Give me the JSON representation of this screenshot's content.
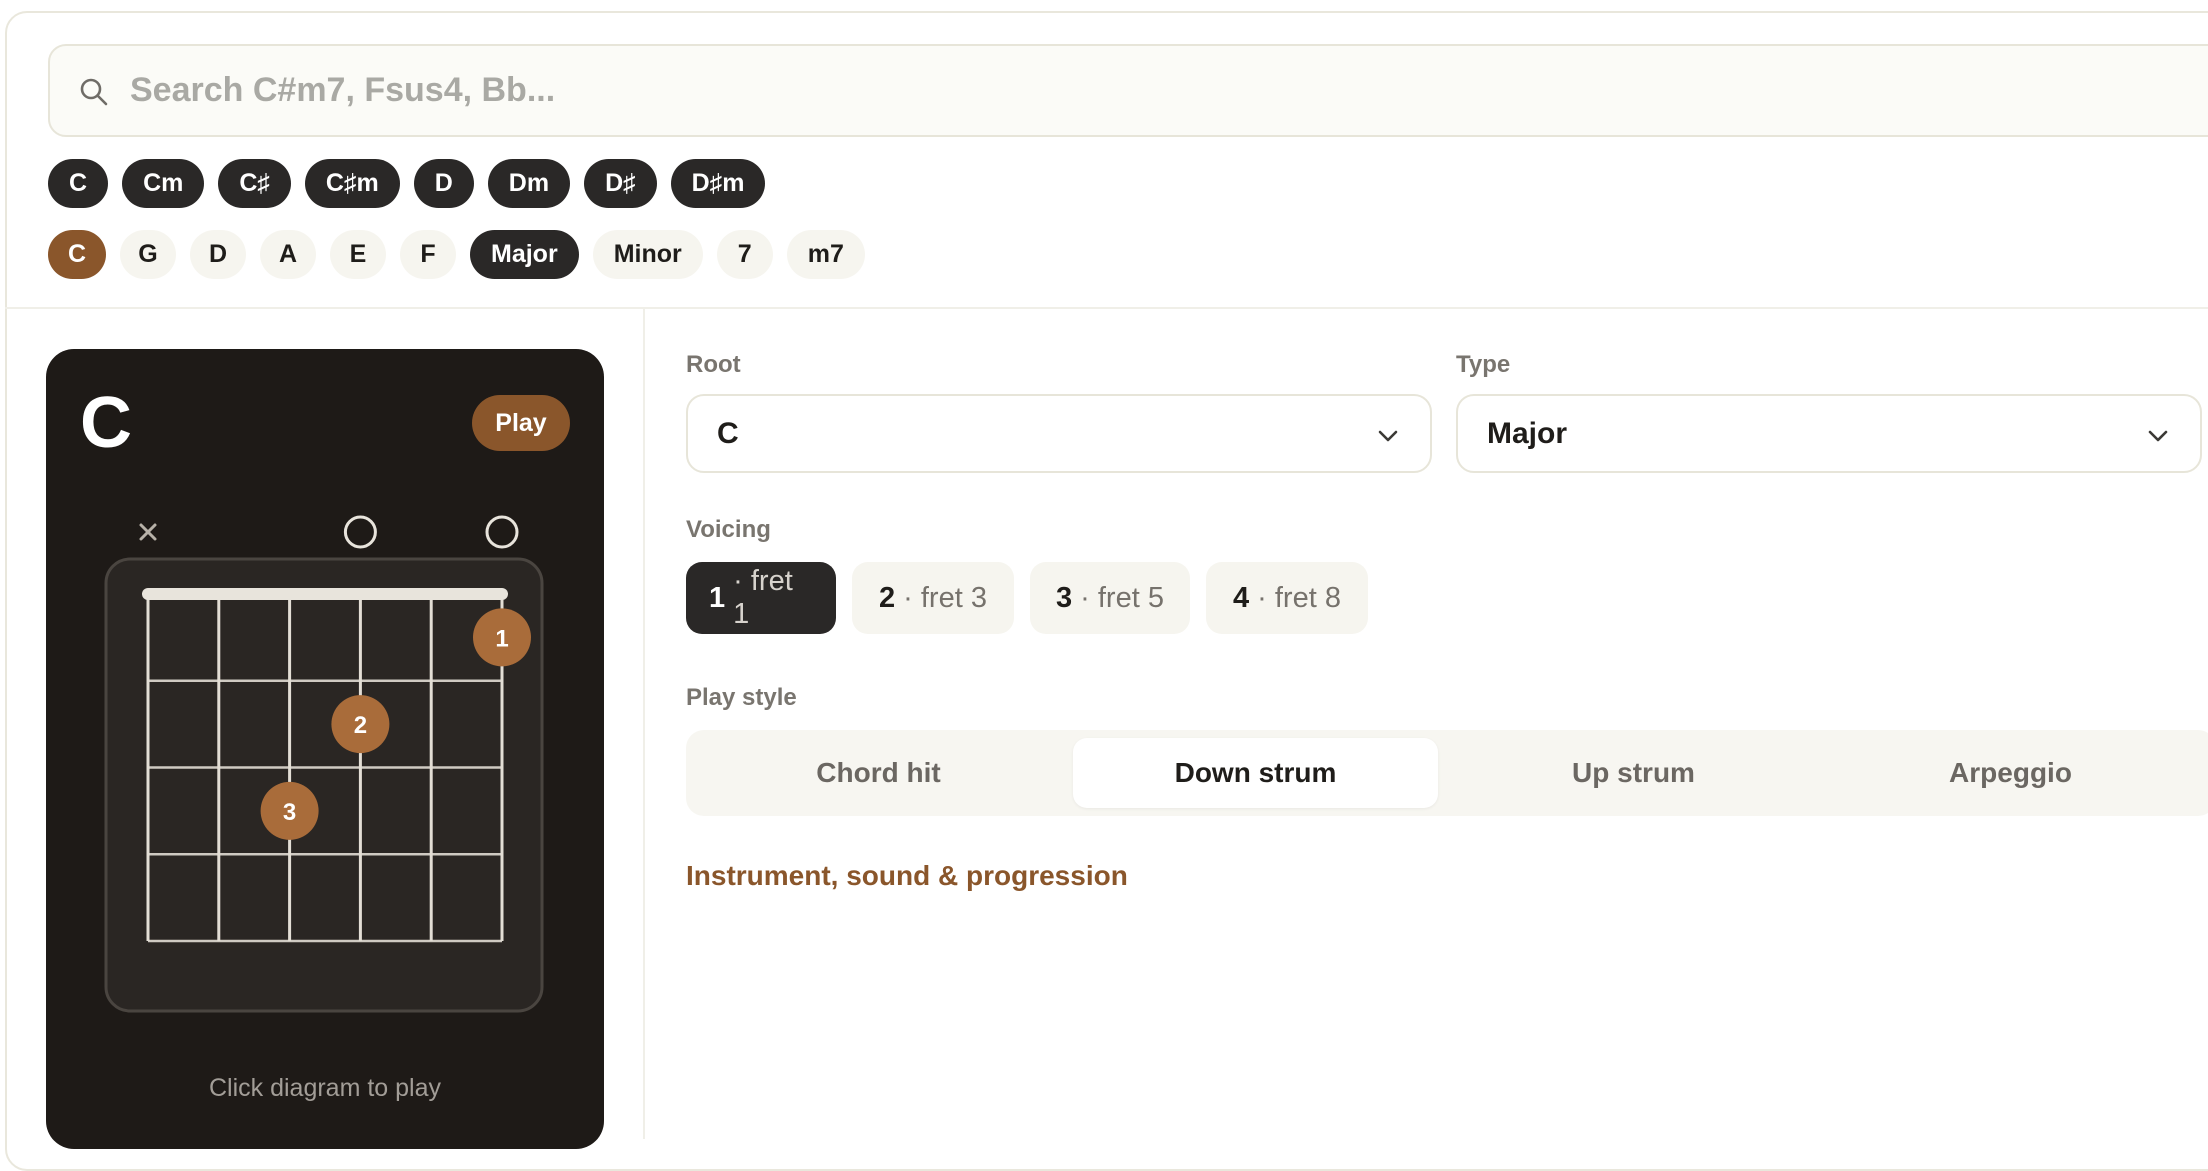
{
  "search": {
    "placeholder": "Search C#m7, Fsus4, Bb...",
    "value": ""
  },
  "recent_chords": [
    "C",
    "Cm",
    "C♯",
    "C♯m",
    "D",
    "Dm",
    "D♯",
    "D♯m"
  ],
  "quick_filters": {
    "roots": [
      "C",
      "G",
      "D",
      "A",
      "E",
      "F"
    ],
    "selected_root": "C",
    "types": [
      "Major",
      "Minor",
      "7",
      "m7"
    ],
    "selected_type": "Major"
  },
  "chord_card": {
    "name": "C",
    "play_label": "Play",
    "caption": "Click diagram to play",
    "diagram": {
      "strings": 6,
      "frets": 4,
      "string_markers": [
        "x",
        "",
        "",
        "o",
        "",
        "o"
      ],
      "fingers": [
        {
          "string": 5,
          "fret": 1,
          "label": "1"
        },
        {
          "string": 3,
          "fret": 2,
          "label": "2"
        },
        {
          "string": 2,
          "fret": 3,
          "label": "3"
        }
      ]
    }
  },
  "root_field": {
    "label": "Root",
    "value": "C"
  },
  "type_field": {
    "label": "Type",
    "value": "Major"
  },
  "voicing": {
    "label": "Voicing",
    "options": [
      {
        "num": "1",
        "fret": "· fret 1"
      },
      {
        "num": "2",
        "fret": "· fret 3"
      },
      {
        "num": "3",
        "fret": "· fret 5"
      },
      {
        "num": "4",
        "fret": "· fret 8"
      }
    ],
    "selected_index": 0
  },
  "play_style": {
    "label": "Play style",
    "options": [
      "Chord hit",
      "Down strum",
      "Up strum",
      "Arpeggio"
    ],
    "selected_index": 1
  },
  "more_link": "Instrument, sound & progression",
  "colors": {
    "accent": "#8a562b",
    "dark": "#2a2827",
    "card_bg": "#1e1a17"
  }
}
